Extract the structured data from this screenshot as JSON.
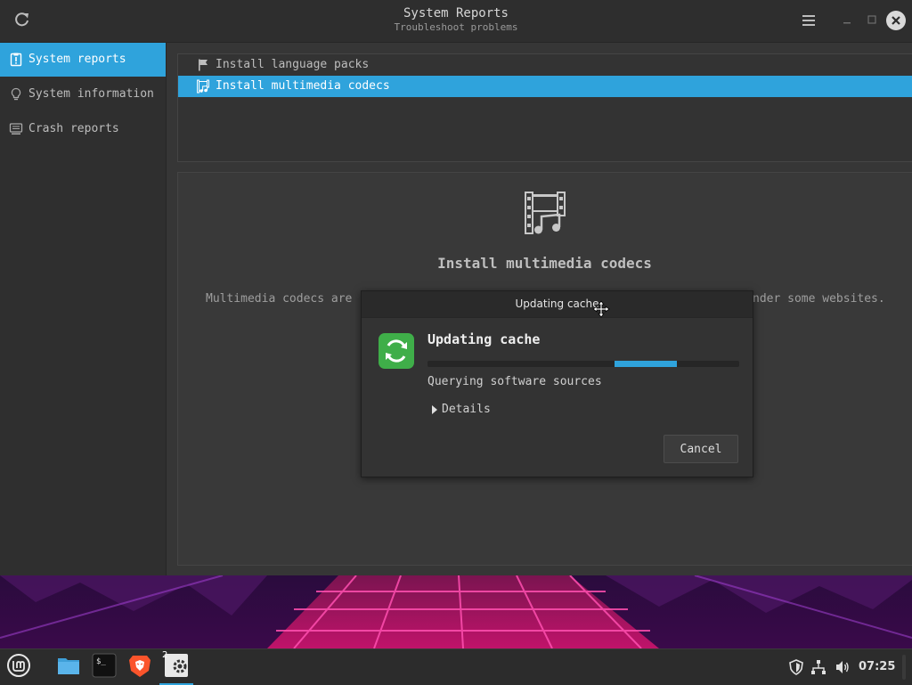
{
  "window": {
    "title": "System Reports",
    "subtitle": "Troubleshoot problems"
  },
  "sidebar": {
    "items": [
      {
        "label": "System reports",
        "icon": "report-icon",
        "active": true
      },
      {
        "label": "System information",
        "icon": "lightbulb-icon",
        "active": false
      },
      {
        "label": "Crash reports",
        "icon": "computer-icon",
        "active": false
      }
    ]
  },
  "actions": [
    {
      "label": "Install language packs",
      "icon": "flag-icon",
      "selected": false
    },
    {
      "label": "Install multimedia codecs",
      "icon": "film-music-icon",
      "selected": true
    }
  ],
  "detail": {
    "title": "Install multimedia codecs",
    "description_left": "Multimedia codecs are",
    "description_right": "nder some websites."
  },
  "dialog": {
    "title": "Updating cache",
    "heading": "Updating cache",
    "status": "Querying software sources",
    "details_label": "Details",
    "cancel_label": "Cancel",
    "progress": {
      "mode": "indeterminate",
      "pulse_start": 0.6,
      "pulse_end": 0.8
    }
  },
  "taskbar": {
    "apps": [
      {
        "name": "mint-menu",
        "icon": "mint-logo-icon"
      },
      {
        "name": "files",
        "icon": "folder-icon"
      },
      {
        "name": "terminal",
        "icon": "terminal-icon"
      },
      {
        "name": "brave",
        "icon": "brave-lion-icon"
      },
      {
        "name": "system-reports",
        "icon": "settings-app-icon",
        "badge": "2",
        "active": true
      }
    ],
    "clock": "07:25"
  },
  "colors": {
    "accent": "#2fa3dc",
    "dialog_icon_green": "#3fae49"
  }
}
